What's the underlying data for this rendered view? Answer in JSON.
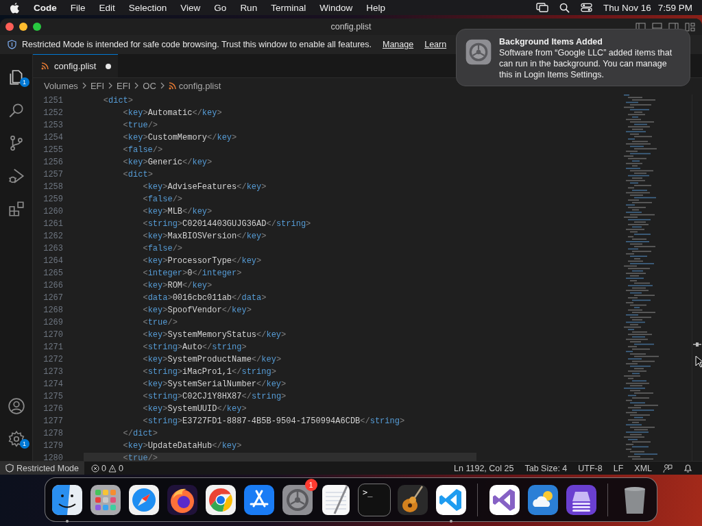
{
  "menu_bar": {
    "app": "Code",
    "items": [
      "File",
      "Edit",
      "Selection",
      "View",
      "Go",
      "Run",
      "Terminal",
      "Window",
      "Help"
    ],
    "date": "Thu Nov 16",
    "time": "7:59 PM"
  },
  "window": {
    "title": "config.plist"
  },
  "banner": {
    "message": "Restricted Mode is intended for safe code browsing. Trust this window to enable all features.",
    "links": [
      "Manage",
      "Learn"
    ]
  },
  "activity_bar": {
    "top": [
      {
        "kind": "explorer",
        "badge": "1"
      },
      {
        "kind": "search"
      },
      {
        "kind": "source_control"
      },
      {
        "kind": "debug"
      },
      {
        "kind": "extensions"
      }
    ],
    "bottom": [
      {
        "kind": "account"
      },
      {
        "kind": "settings",
        "badge": "1"
      }
    ]
  },
  "tabs": [
    {
      "label": "config.plist",
      "selected": true,
      "modified": true
    }
  ],
  "breadcrumb": [
    "Volumes",
    "EFI",
    "EFI",
    "OC",
    "config.plist"
  ],
  "editor": {
    "lines": [
      {
        "number": "1251",
        "text": "    <dict>"
      },
      {
        "number": "1252",
        "text": "        <key>Automatic</key>"
      },
      {
        "number": "1253",
        "text": "        <true/>"
      },
      {
        "number": "1254",
        "text": "        <key>CustomMemory</key>"
      },
      {
        "number": "1255",
        "text": "        <false/>"
      },
      {
        "number": "1256",
        "text": "        <key>Generic</key>"
      },
      {
        "number": "1257",
        "text": "        <dict>"
      },
      {
        "number": "1258",
        "text": "            <key>AdviseFeatures</key>"
      },
      {
        "number": "1259",
        "text": "            <false/>"
      },
      {
        "number": "1260",
        "text": "            <key>MLB</key>"
      },
      {
        "number": "1261",
        "text": "            <string>C02014403GUJG36AD</string>"
      },
      {
        "number": "1262",
        "text": "            <key>MaxBIOSVersion</key>"
      },
      {
        "number": "1263",
        "text": "            <false/>"
      },
      {
        "number": "1264",
        "text": "            <key>ProcessorType</key>"
      },
      {
        "number": "1265",
        "text": "            <integer>0</integer>"
      },
      {
        "number": "1266",
        "text": "            <key>ROM</key>"
      },
      {
        "number": "1267",
        "text": "            <data>0016cbc011ab</data>"
      },
      {
        "number": "1268",
        "text": "            <key>SpoofVendor</key>"
      },
      {
        "number": "1269",
        "text": "            <true/>"
      },
      {
        "number": "1270",
        "text": "            <key>SystemMemoryStatus</key>"
      },
      {
        "number": "1271",
        "text": "            <string>Auto</string>"
      },
      {
        "number": "1272",
        "text": "            <key>SystemProductName</key>"
      },
      {
        "number": "1273",
        "text": "            <string>iMacPro1,1</string>"
      },
      {
        "number": "1274",
        "text": "            <key>SystemSerialNumber</key>"
      },
      {
        "number": "1275",
        "text": "            <string>C02CJ1Y8HX87</string>"
      },
      {
        "number": "1276",
        "text": "            <key>SystemUUID</key>"
      },
      {
        "number": "1277",
        "text": "            <string>E3727FD1-8887-4B5B-9504-1750994A6CDB</string>"
      },
      {
        "number": "1278",
        "text": "        </dict>"
      },
      {
        "number": "1279",
        "text": "        <key>UpdateDataHub</key>"
      },
      {
        "number": "1280",
        "text": "        <true/>"
      }
    ]
  },
  "status_bar": {
    "mode": "Restricted Mode",
    "errors": "0",
    "warnings": "0",
    "items": [
      "Ln 1192, Col 25",
      "Tab Size: 4",
      "UTF-8",
      "LF",
      "XML"
    ]
  },
  "notification": {
    "title": "Background Items Added",
    "body": "Software from “Google LLC” added items that can run in the background. You can manage this in Login Items Settings."
  },
  "dock": [
    {
      "kind": "finder",
      "running": true
    },
    {
      "kind": "launchpad",
      "running": false
    },
    {
      "kind": "safari",
      "running": false
    },
    {
      "kind": "firefox",
      "running": false
    },
    {
      "kind": "chrome",
      "running": false
    },
    {
      "kind": "appstore",
      "running": false
    },
    {
      "kind": "settings",
      "running": false,
      "badge": "1"
    },
    {
      "kind": "textedit",
      "running": false
    },
    {
      "kind": "terminal",
      "running": false,
      "glyph": ">_"
    },
    {
      "kind": "garageband",
      "running": false
    },
    {
      "kind": "vscode",
      "running": true
    },
    {
      "kind": "separator"
    },
    {
      "kind": "visualstudio",
      "running": false
    },
    {
      "kind": "weather",
      "running": false
    },
    {
      "kind": "disk",
      "running": false
    },
    {
      "kind": "separator"
    },
    {
      "kind": "trash",
      "running": false
    }
  ]
}
